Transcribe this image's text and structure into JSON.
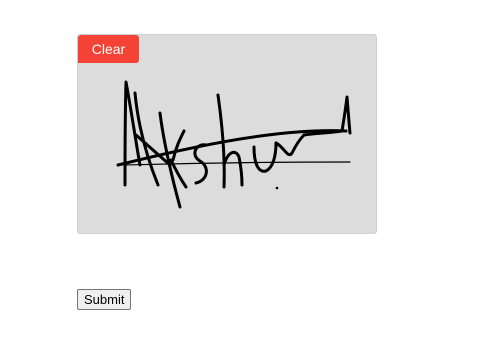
{
  "signature_pad": {
    "clear_label": "Clear",
    "clear_color": "#f44336",
    "ink_color": "#000000",
    "background_color": "#dcdcdc"
  },
  "form": {
    "submit_label": "Submit"
  }
}
